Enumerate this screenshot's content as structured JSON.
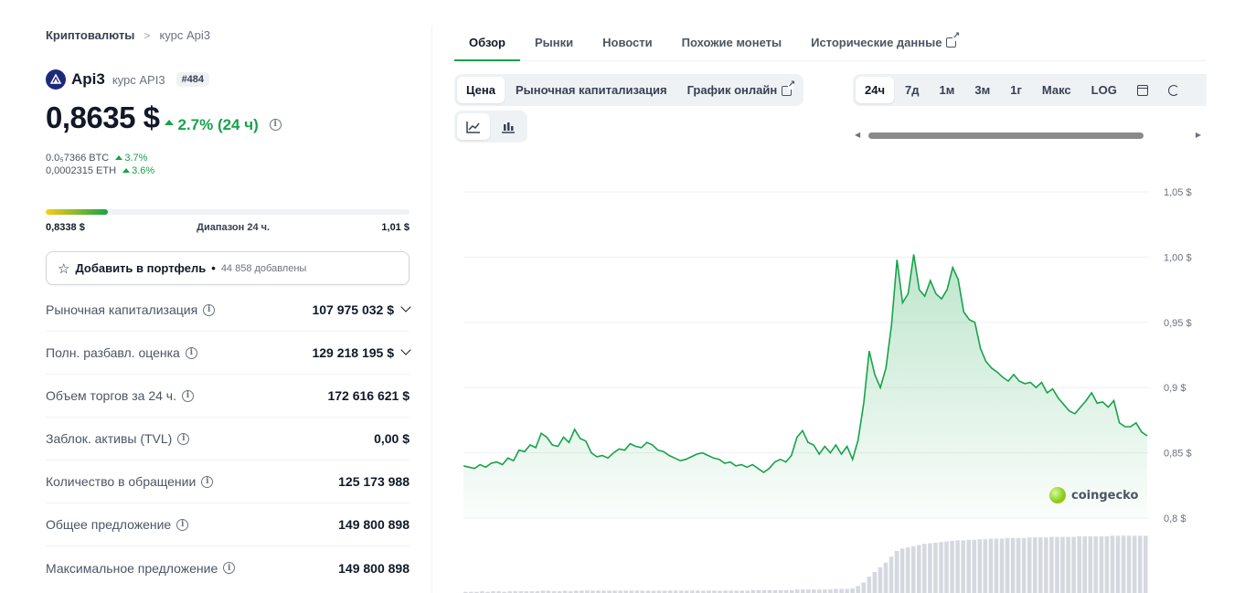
{
  "breadcrumb": {
    "root": "Криптовалюты",
    "separator": ">",
    "current": "курс Api3"
  },
  "coin": {
    "name": "Api3",
    "subtitle": "курс API3",
    "rank": "#484",
    "price": "0,8635 $",
    "change": "2.7% (24 ч)",
    "btc_price": "0.0₅7366 BTC",
    "btc_change": "3.7%",
    "eth_price": "0,0002315 ETH",
    "eth_change": "3.6%"
  },
  "range24h": {
    "low": "0,8338 $",
    "label": "Диапазон 24 ч.",
    "high": "1,01 $",
    "position_fraction": 0.17
  },
  "portfolio": {
    "label": "Добавить в портфель",
    "bullet": "•",
    "count": "44 858 добавлены"
  },
  "stats": [
    {
      "label": "Рыночная капитализация",
      "value": "107 975 032 $",
      "expandable": true
    },
    {
      "label": "Полн. разбавл. оценка",
      "value": "129 218 195 $",
      "expandable": true
    },
    {
      "label": "Объем торгов за 24 ч.",
      "value": "172 616 621 $",
      "expandable": false
    },
    {
      "label": "Заблок. активы (TVL)",
      "value": "0,00 $",
      "expandable": false
    },
    {
      "label": "Количество в обращении",
      "value": "125 173 988",
      "expandable": false
    },
    {
      "label": "Общее предложение",
      "value": "149 800 898",
      "expandable": false
    },
    {
      "label": "Максимальное предложение",
      "value": "149 800 898",
      "expandable": false
    }
  ],
  "tabs": [
    "Обзор",
    "Рынки",
    "Новости",
    "Похожие монеты",
    "Исторические данные"
  ],
  "chart_modes": [
    "Цена",
    "Рыночная капитализация",
    "График онлайн"
  ],
  "ranges": [
    "24ч",
    "7д",
    "1м",
    "3м",
    "1г",
    "Макс",
    "LOG"
  ],
  "icons": {
    "calendar": "calendar-icon",
    "refresh": "refresh-icon",
    "line": "line-chart-icon",
    "candle": "candlestick-icon"
  },
  "watermark": "coingecko",
  "colors": {
    "accent": "#16a34a",
    "line": "#16a34a"
  },
  "chart_data": {
    "type": "area",
    "title": "",
    "xlabel": "",
    "ylabel": "",
    "ylim": [
      0.8,
      1.05
    ],
    "yticks": [
      "1,05 $",
      "1,00 $",
      "0,95 $",
      "0,9 $",
      "0,85 $",
      "0,8 $"
    ],
    "ytick_values": [
      1.05,
      1.0,
      0.95,
      0.9,
      0.85,
      0.8
    ],
    "series": [
      {
        "values": [
          0.84,
          0.839,
          0.838,
          0.841,
          0.839,
          0.842,
          0.843,
          0.841,
          0.846,
          0.844,
          0.852,
          0.851,
          0.856,
          0.854,
          0.865,
          0.862,
          0.856,
          0.855,
          0.862,
          0.858,
          0.868,
          0.861,
          0.859,
          0.85,
          0.847,
          0.848,
          0.846,
          0.85,
          0.853,
          0.852,
          0.857,
          0.855,
          0.854,
          0.858,
          0.856,
          0.852,
          0.851,
          0.848,
          0.846,
          0.844,
          0.845,
          0.847,
          0.849,
          0.85,
          0.848,
          0.846,
          0.845,
          0.842,
          0.843,
          0.84,
          0.841,
          0.839,
          0.841,
          0.838,
          0.835,
          0.838,
          0.843,
          0.845,
          0.843,
          0.848,
          0.862,
          0.867,
          0.858,
          0.856,
          0.849,
          0.855,
          0.85,
          0.856,
          0.849,
          0.855,
          0.845,
          0.86,
          0.888,
          0.928,
          0.91,
          0.9,
          0.915,
          0.948,
          0.998,
          0.965,
          0.972,
          1.002,
          0.975,
          0.97,
          0.982,
          0.972,
          0.968,
          0.975,
          0.992,
          0.983,
          0.958,
          0.952,
          0.95,
          0.93,
          0.92,
          0.915,
          0.912,
          0.908,
          0.905,
          0.91,
          0.905,
          0.903,
          0.904,
          0.9,
          0.904,
          0.896,
          0.899,
          0.892,
          0.887,
          0.882,
          0.88,
          0.885,
          0.89,
          0.896,
          0.888,
          0.889,
          0.885,
          0.89,
          0.873,
          0.87,
          0.87,
          0.873,
          0.866,
          0.863
        ]
      }
    ],
    "volume": [
      0.02,
      0.02,
      0.02,
      0.03,
      0.02,
      0.03,
      0.03,
      0.02,
      0.03,
      0.03,
      0.03,
      0.03,
      0.03,
      0.03,
      0.04,
      0.04,
      0.03,
      0.03,
      0.04,
      0.03,
      0.04,
      0.04,
      0.04,
      0.04,
      0.04,
      0.04,
      0.04,
      0.04,
      0.04,
      0.04,
      0.04,
      0.04,
      0.04,
      0.04,
      0.04,
      0.04,
      0.04,
      0.04,
      0.04,
      0.04,
      0.04,
      0.04,
      0.04,
      0.04,
      0.04,
      0.04,
      0.04,
      0.04,
      0.04,
      0.04,
      0.04,
      0.04,
      0.05,
      0.05,
      0.05,
      0.05,
      0.05,
      0.05,
      0.05,
      0.05,
      0.06,
      0.06,
      0.06,
      0.06,
      0.06,
      0.06,
      0.06,
      0.07,
      0.07,
      0.07,
      0.08,
      0.12,
      0.18,
      0.28,
      0.36,
      0.44,
      0.52,
      0.62,
      0.72,
      0.76,
      0.78,
      0.8,
      0.82,
      0.84,
      0.85,
      0.86,
      0.87,
      0.88,
      0.89,
      0.9,
      0.9,
      0.91,
      0.91,
      0.92,
      0.92,
      0.93,
      0.93,
      0.93,
      0.94,
      0.94,
      0.94,
      0.94,
      0.95,
      0.95,
      0.95,
      0.95,
      0.96,
      0.96,
      0.96,
      0.96,
      0.96,
      0.97,
      0.97,
      0.97,
      0.97,
      0.97,
      0.97,
      0.98,
      0.98,
      0.98,
      0.98,
      0.98,
      0.98,
      0.98
    ]
  }
}
